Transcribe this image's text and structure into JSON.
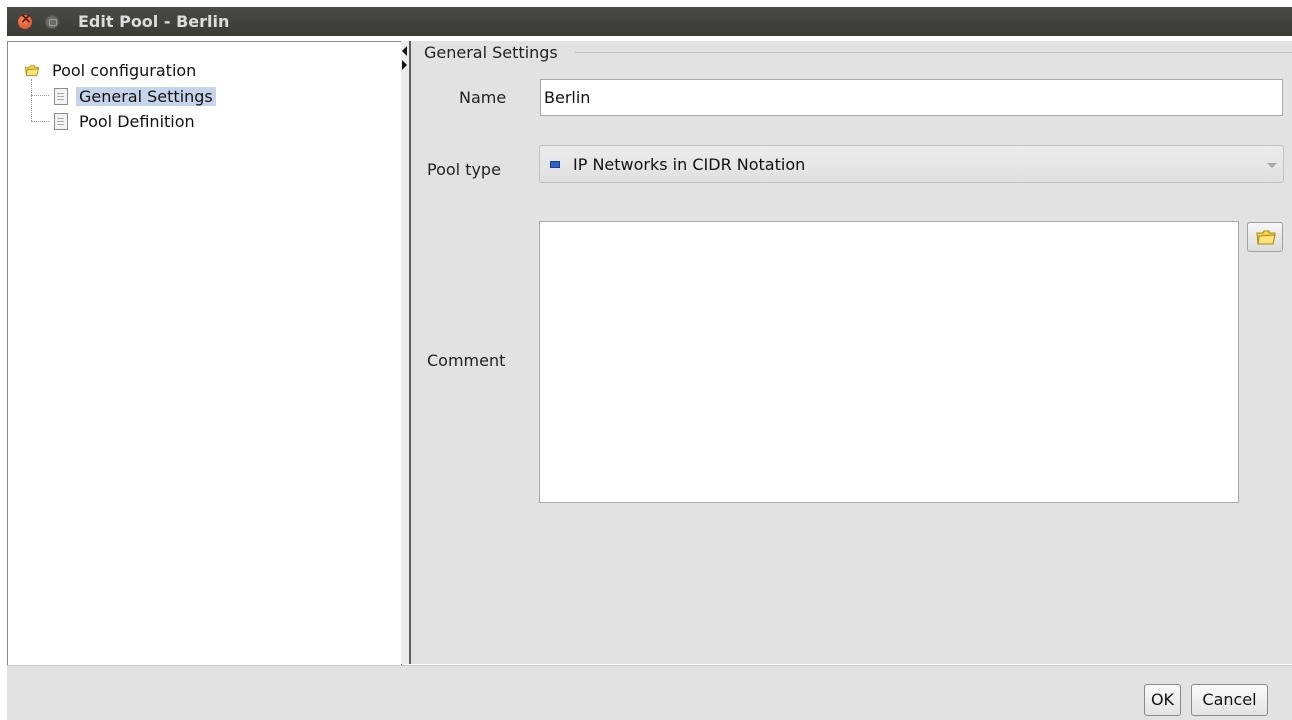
{
  "window": {
    "title": "Edit Pool - Berlin"
  },
  "tree": {
    "root": {
      "label": "Pool configuration",
      "icon": "folder-icon"
    },
    "items": [
      {
        "label": "General Settings",
        "icon": "document-icon",
        "selected": true
      },
      {
        "label": "Pool Definition",
        "icon": "document-icon",
        "selected": false
      }
    ]
  },
  "form": {
    "group_title": "General Settings",
    "name_label": "Name",
    "name_value": "Berlin",
    "pool_type_label": "Pool type",
    "pool_type_value": "IP Networks in CIDR Notation",
    "comment_label": "Comment",
    "comment_value": ""
  },
  "buttons": {
    "ok": "OK",
    "cancel": "Cancel"
  },
  "colors": {
    "selection": "#c6d4ea",
    "titlebar": "#3c3c39",
    "panel": "#e2e2e2",
    "close": "#e0582a"
  }
}
